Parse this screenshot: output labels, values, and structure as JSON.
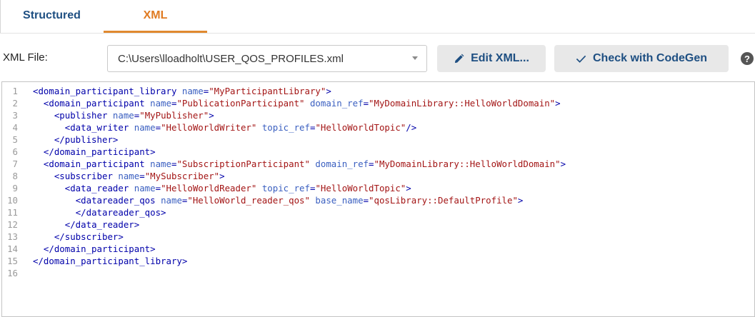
{
  "tabs": [
    {
      "label": "Structured",
      "active": false
    },
    {
      "label": "XML",
      "active": true
    }
  ],
  "file": {
    "label": "XML File:",
    "value": "C:\\Users\\lloadholt\\USER_QOS_PROFILES.xml"
  },
  "buttons": {
    "edit_xml": "Edit XML...",
    "check_codegen": "Check with CodeGen",
    "help": "?"
  },
  "colors": {
    "active_tab": "#e07b22",
    "tab_text": "#1e4f82",
    "button_bg": "#e8e8e8",
    "xml_tag": "#0000aa",
    "xml_attr": "#3a5fc0",
    "xml_string": "#a31515"
  },
  "icons": [
    "pencil-icon",
    "checkmark-icon",
    "help-icon",
    "chevron-down-icon"
  ],
  "editor": {
    "lines": [
      {
        "n": "1",
        "text": "<domain_participant_library name=\"MyParticipantLibrary\">"
      },
      {
        "n": "2",
        "text": "  <domain_participant name=\"PublicationParticipant\" domain_ref=\"MyDomainLibrary::HelloWorldDomain\">"
      },
      {
        "n": "3",
        "text": "    <publisher name=\"MyPublisher\">"
      },
      {
        "n": "4",
        "text": "      <data_writer name=\"HelloWorldWriter\" topic_ref=\"HelloWorldTopic\"/>"
      },
      {
        "n": "5",
        "text": "    </publisher>"
      },
      {
        "n": "6",
        "text": "  </domain_participant>"
      },
      {
        "n": "7",
        "text": "  <domain_participant name=\"SubscriptionParticipant\" domain_ref=\"MyDomainLibrary::HelloWorldDomain\">"
      },
      {
        "n": "8",
        "text": "    <subscriber name=\"MySubscriber\">"
      },
      {
        "n": "9",
        "text": "      <data_reader name=\"HelloWorldReader\" topic_ref=\"HelloWorldTopic\">"
      },
      {
        "n": "10",
        "text": "        <datareader_qos name=\"HelloWorld_reader_qos\" base_name=\"qosLibrary::DefaultProfile\">"
      },
      {
        "n": "11",
        "text": "        </datareader_qos>"
      },
      {
        "n": "12",
        "text": "      </data_reader>"
      },
      {
        "n": "13",
        "text": "    </subscriber>"
      },
      {
        "n": "14",
        "text": "  </domain_participant>"
      },
      {
        "n": "15",
        "text": "</domain_participant_library>"
      },
      {
        "n": "16",
        "text": ""
      }
    ]
  }
}
